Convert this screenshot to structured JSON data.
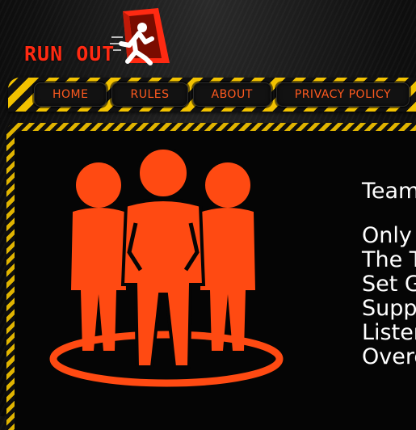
{
  "logo": {
    "text": "RUN OUT"
  },
  "nav": {
    "items": [
      {
        "label": "HOME"
      },
      {
        "label": "RULES"
      },
      {
        "label": "ABOUT"
      },
      {
        "label": "PRIVACY POLICY"
      }
    ]
  },
  "content": {
    "heading": "Team",
    "lines": [
      "Only T",
      "The Te",
      "Set G",
      "Suppo",
      "Listen",
      "Overc"
    ]
  },
  "colors": {
    "accent": "#ff4a12",
    "hazard_yellow": "#f2c200",
    "background": "#0b0b0b",
    "text": "#ffffff"
  },
  "icons": {
    "logo_runner": "runner-icon",
    "logo_door": "door-icon",
    "team": "team-icon"
  }
}
